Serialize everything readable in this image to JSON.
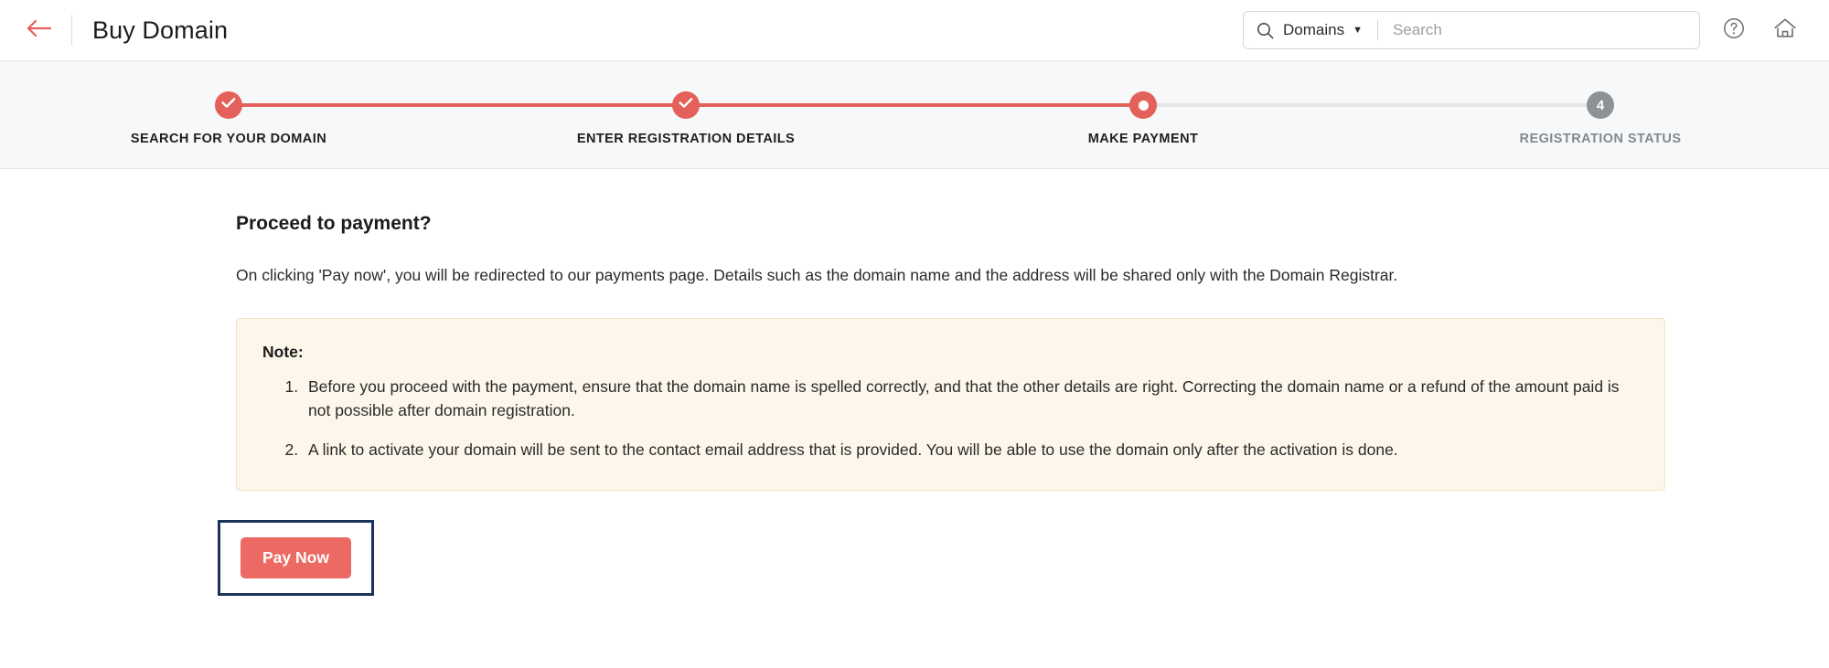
{
  "header": {
    "back_icon": "arrow-left-icon",
    "title": "Buy Domain",
    "search": {
      "icon": "search-icon",
      "scope_label": "Domains",
      "caret": "▼",
      "placeholder": "Search",
      "value": ""
    },
    "help_icon": "help-circle-icon",
    "home_icon": "home-icon"
  },
  "stepper": {
    "accent_color": "#e4605a",
    "inactive_color": "#8e9296",
    "steps": [
      {
        "label": "SEARCH FOR YOUR DOMAIN",
        "state": "done",
        "marker": "check"
      },
      {
        "label": "ENTER REGISTRATION DETAILS",
        "state": "done",
        "marker": "check"
      },
      {
        "label": "MAKE PAYMENT",
        "state": "current",
        "marker": "dot"
      },
      {
        "label": "REGISTRATION STATUS",
        "state": "todo",
        "marker": "4"
      }
    ]
  },
  "main": {
    "section_title": "Proceed to payment?",
    "lead": "On clicking 'Pay now', you will be redirected to our payments page. Details such as the domain name and the address will be shared only with the Domain Registrar.",
    "note": {
      "title": "Note:",
      "background": "#fdf6ea",
      "border": "#f0e3c8",
      "items": [
        "Before you proceed with the payment, ensure that the domain name is spelled correctly, and that the other details are right. Correcting the domain name or a refund of the amount paid is not possible after domain registration.",
        "A link to activate your domain will be sent to the contact email address that is provided. You will be able to use the domain only after the activation is done."
      ]
    },
    "pay_button": {
      "label": "Pay Now",
      "color": "#ec6a63",
      "focus_outline_color": "#1b3259"
    }
  }
}
